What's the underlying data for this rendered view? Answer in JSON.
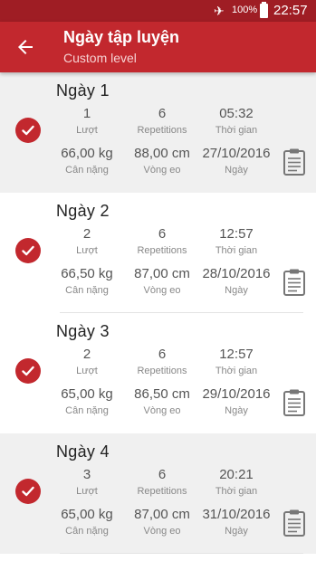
{
  "status_bar": {
    "airplane_icon": "airplane-icon",
    "battery_percent": "100%",
    "battery_icon": "battery-full-icon",
    "time": "22:57"
  },
  "app_bar": {
    "back_icon": "arrow-back-icon",
    "title": "Ngày tập luyện",
    "subtitle": "Custom level",
    "color": "#c2282e"
  },
  "labels": {
    "sets": "Lượt",
    "repetitions": "Repetitions",
    "time": "Thời gian",
    "weight": "Cân nặng",
    "waist": "Vòng eo",
    "date": "Ngày"
  },
  "days": [
    {
      "title": "Ngày 1",
      "sets": "1",
      "repetitions": "6",
      "time": "05:32",
      "weight": "66,00 kg",
      "waist": "88,00 cm",
      "date": "27/10/2016",
      "completed": true
    },
    {
      "title": "Ngày 2",
      "sets": "2",
      "repetitions": "6",
      "time": "12:57",
      "weight": "66,50 kg",
      "waist": "87,00 cm",
      "date": "28/10/2016",
      "completed": true
    },
    {
      "title": "Ngày 3",
      "sets": "2",
      "repetitions": "6",
      "time": "12:57",
      "weight": "65,00 kg",
      "waist": "86,50 cm",
      "date": "29/10/2016",
      "completed": true
    },
    {
      "title": "Ngày 4",
      "sets": "3",
      "repetitions": "6",
      "time": "20:21",
      "weight": "65,00 kg",
      "waist": "87,00 cm",
      "date": "31/10/2016",
      "completed": true
    }
  ]
}
